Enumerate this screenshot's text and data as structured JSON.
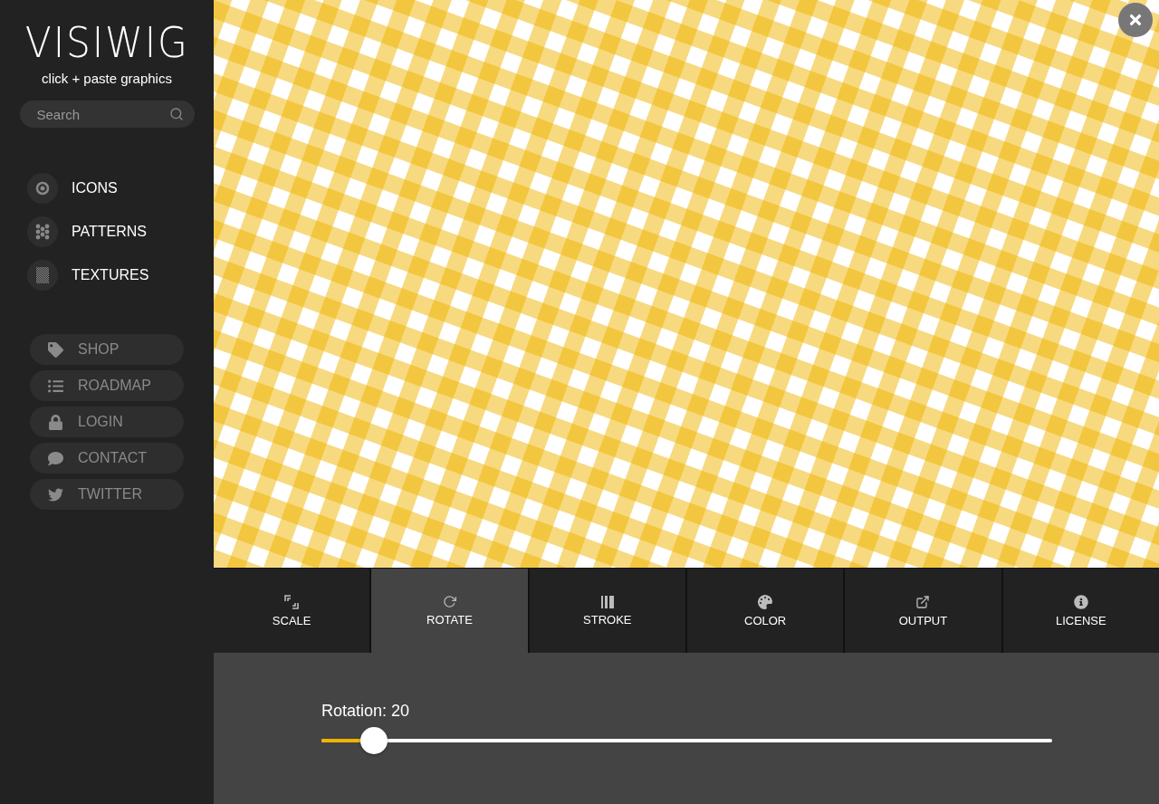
{
  "brand": {
    "logo": "VISIWIG",
    "tagline": "click + paste graphics"
  },
  "search": {
    "placeholder": "Search"
  },
  "categories": [
    {
      "label": "ICONS"
    },
    {
      "label": "PATTERNS"
    },
    {
      "label": "TEXTURES"
    }
  ],
  "links": [
    {
      "label": "SHOP"
    },
    {
      "label": "ROADMAP"
    },
    {
      "label": "LOGIN"
    },
    {
      "label": "CONTACT"
    },
    {
      "label": "TWITTER"
    }
  ],
  "tabs": [
    {
      "label": "SCALE",
      "selected": false
    },
    {
      "label": "ROTATE",
      "selected": true
    },
    {
      "label": "STROKE",
      "selected": false
    },
    {
      "label": "COLOR",
      "selected": false
    },
    {
      "label": "OUTPUT",
      "selected": false
    },
    {
      "label": "LICENSE",
      "selected": false
    }
  ],
  "rotation": {
    "label": "Rotation: 20",
    "level": 0.072
  }
}
